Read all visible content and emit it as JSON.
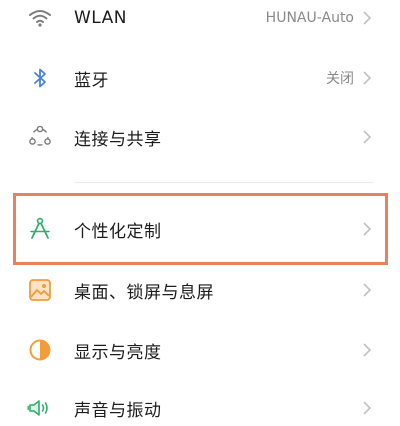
{
  "settings": {
    "items": [
      {
        "label": "WLAN",
        "value": "HUNAU-Auto",
        "icon": "wifi-icon"
      },
      {
        "label": "蓝牙",
        "value": "关闭",
        "icon": "bluetooth-icon"
      },
      {
        "label": "连接与共享",
        "value": "",
        "icon": "share-connection-icon"
      },
      {
        "label": "个性化定制",
        "value": "",
        "icon": "compass-icon"
      },
      {
        "label": "桌面、锁屏与息屏",
        "value": "",
        "icon": "wallpaper-icon"
      },
      {
        "label": "显示与亮度",
        "value": "",
        "icon": "brightness-icon"
      },
      {
        "label": "声音与振动",
        "value": "",
        "icon": "speaker-icon"
      }
    ]
  },
  "colors": {
    "highlight_border": "#e8825c",
    "icon_gray": "#7d7d7d",
    "icon_blue": "#4a7fe0",
    "icon_green": "#2fae6d",
    "icon_orange": "#f39c3a",
    "chevron": "#c2c2c2"
  }
}
